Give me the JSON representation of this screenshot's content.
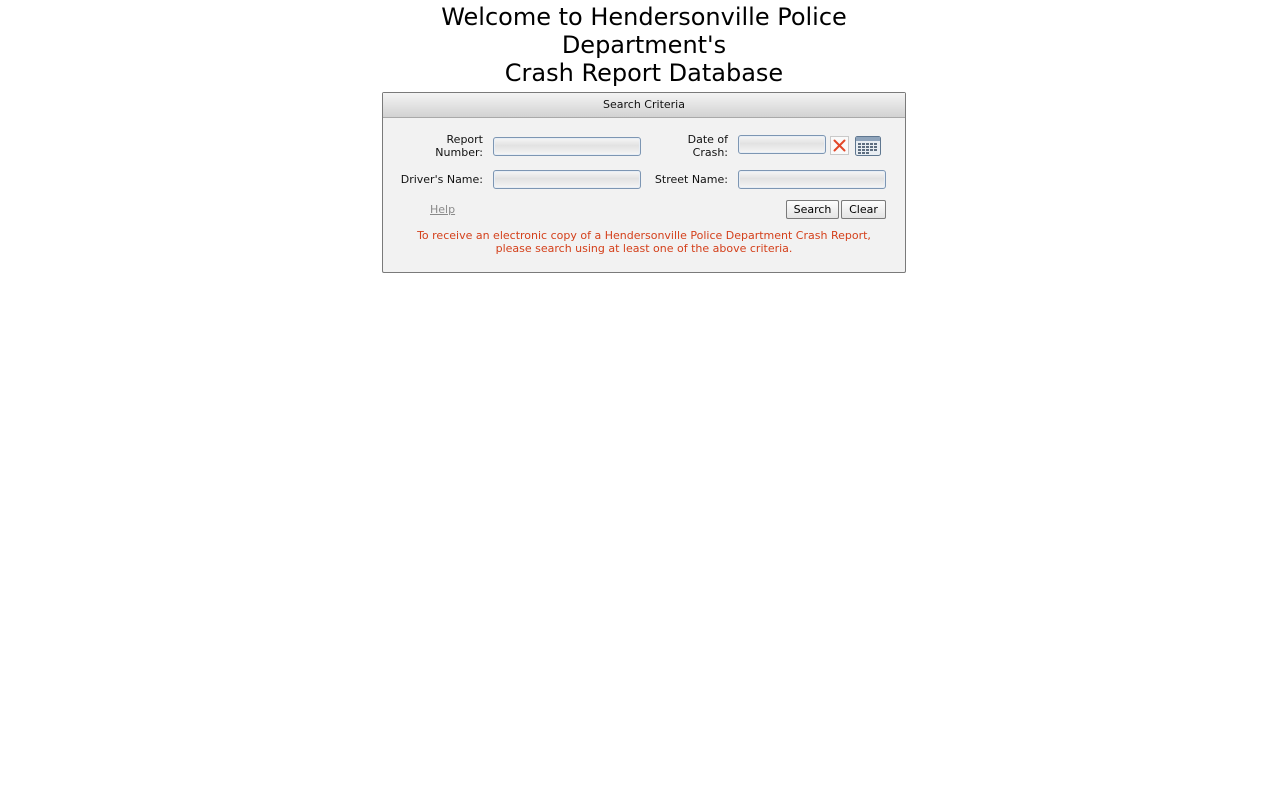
{
  "header": {
    "title_line1": "Welcome to Hendersonville Police",
    "title_line2": "Department's",
    "title_line3": "Crash Report Database"
  },
  "search_panel": {
    "title": "Search Criteria",
    "fields": {
      "report_number": {
        "label_line1": "Report",
        "label_line2": "Number:",
        "value": "",
        "placeholder": ""
      },
      "date_of_crash": {
        "label_line1": "Date of",
        "label_line2": "Crash:",
        "value": "",
        "placeholder": ""
      },
      "drivers_name": {
        "label": "Driver's Name:",
        "value": "",
        "placeholder": ""
      },
      "street_name": {
        "label": "Street Name:",
        "value": "",
        "placeholder": ""
      }
    },
    "help_label": "Help",
    "search_label": "Search",
    "clear_label": "Clear",
    "notice_line1": "To receive an electronic copy of a Hendersonville Police Department Crash Report,",
    "notice_line2": "please search using at least one of the above criteria."
  },
  "icons": {
    "clear_date": "close-icon",
    "calendar": "calendar-icon"
  },
  "colors": {
    "notice": "#d4401b",
    "clear_icon": "#e2482a",
    "input_border": "#7d96b3",
    "panel_bg": "#f2f2f2"
  }
}
